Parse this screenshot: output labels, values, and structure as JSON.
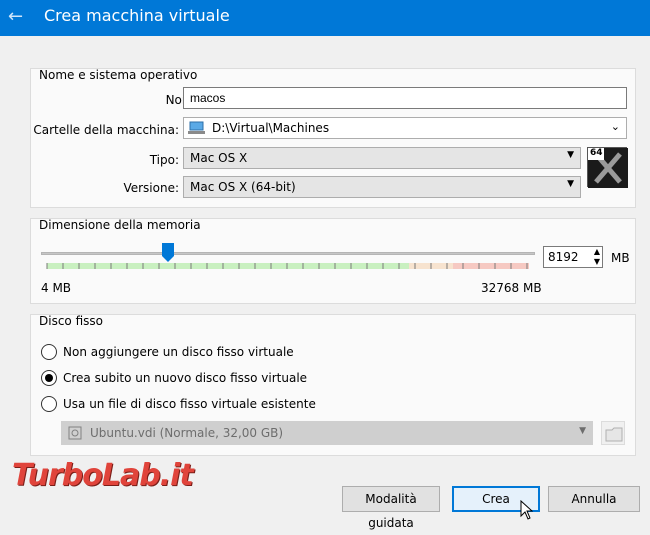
{
  "window": {
    "title": "Crea macchina virtuale",
    "accent": "#0078d7"
  },
  "name_os": {
    "group_title": "Nome e sistema operativo",
    "name_label": "Nome:",
    "name_value": "macos",
    "folder_label": "Cartelle della macchina:",
    "folder_value": "D:\\Virtual\\Machines",
    "type_label": "Tipo:",
    "type_value": "Mac OS X",
    "version_label": "Versione:",
    "version_value": "Mac OS X (64-bit)",
    "os_badge": "64"
  },
  "memory": {
    "group_title": "Dimensione della memoria",
    "value": "8192",
    "unit": "MB",
    "min_label": "4 MB",
    "max_label": "32768 MB",
    "min_mb": 4,
    "max_mb": 32768,
    "current_mb": 8192
  },
  "disk": {
    "group_title": "Disco fisso",
    "options": [
      {
        "label": "Non aggiungere un disco fisso virtuale",
        "checked": false
      },
      {
        "label": "Crea subito un nuovo disco fisso virtuale",
        "checked": true
      },
      {
        "label": "Usa un file di disco fisso virtuale esistente",
        "checked": false
      }
    ],
    "existing_file": "Ubuntu.vdi (Normale, 32,00 GB)"
  },
  "buttons": {
    "guided": "Modalità guidata",
    "create": "Crea",
    "cancel": "Annulla"
  },
  "watermark": "TurboLab.it"
}
